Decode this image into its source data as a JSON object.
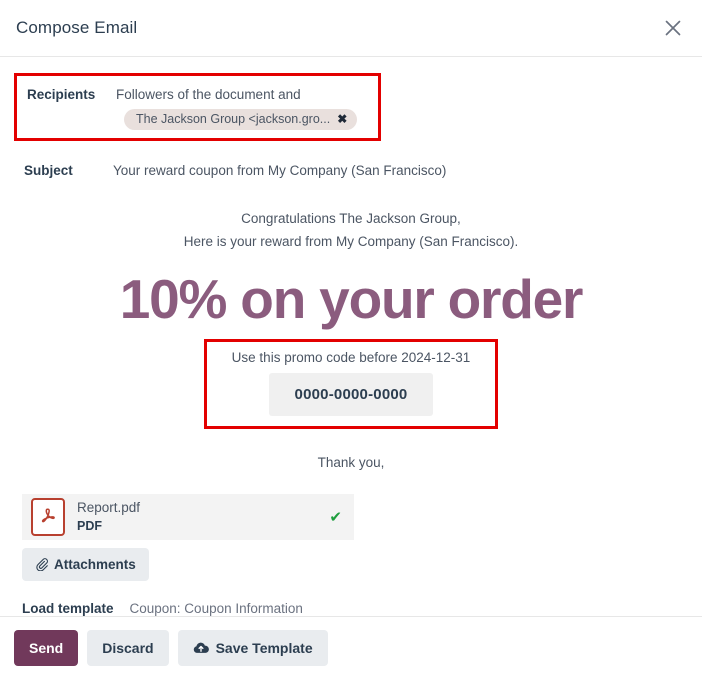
{
  "header": {
    "title": "Compose Email",
    "close_label": "✕"
  },
  "recipients": {
    "label": "Recipients",
    "value": "Followers of the document and",
    "tag": {
      "text": "The Jackson Group <jackson.gro...",
      "remove_label": "✖"
    }
  },
  "subject": {
    "label": "Subject",
    "value": "Your reward coupon from My Company (San Francisco)"
  },
  "email_body": {
    "greeting_line_1": "Congratulations The Jackson Group,",
    "greeting_line_2": "Here is your reward from My Company (San Francisco).",
    "offer_headline": "10% on your order",
    "promo_label": "Use this promo code before 2024-12-31",
    "promo_code": "0000-0000-0000",
    "closing": "Thank you,"
  },
  "attachment": {
    "filename": "Report.pdf",
    "filetype": "PDF",
    "status_icon": "✔",
    "attachments_button_label": "Attachments"
  },
  "load_template": {
    "label": "Load template",
    "value": "Coupon: Coupon Information"
  },
  "footer": {
    "send_label": "Send",
    "discard_label": "Discard",
    "save_template_label": "Save Template"
  },
  "colors": {
    "brand_purple": "#8b5c7e",
    "send_button": "#71395b",
    "highlight_red": "#e30000",
    "pdf_red": "#b8402f",
    "check_green": "#1e9e3e",
    "tag_background": "#e9e0dd"
  }
}
